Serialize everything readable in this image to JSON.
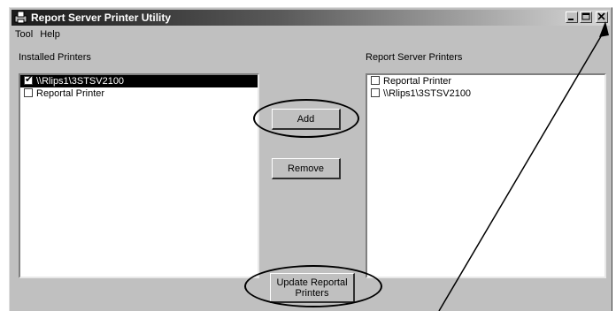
{
  "window": {
    "title": "Report Server Printer Utility"
  },
  "menu": [
    "Tool",
    "Help"
  ],
  "installed": {
    "label": "Installed Printers",
    "items": [
      {
        "name": "\\\\Rlips1\\3STSV2100",
        "checked": true,
        "selected": true
      },
      {
        "name": "Reportal Printer",
        "checked": false,
        "selected": false
      }
    ]
  },
  "server": {
    "label": "Report Server Printers",
    "items": [
      {
        "name": "Reportal Printer",
        "checked": false
      },
      {
        "name": "\\\\Rlips1\\3STSV2100",
        "checked": false
      }
    ]
  },
  "buttons": {
    "add": "Add",
    "remove": "Remove",
    "update": "Update Reportal Printers"
  }
}
